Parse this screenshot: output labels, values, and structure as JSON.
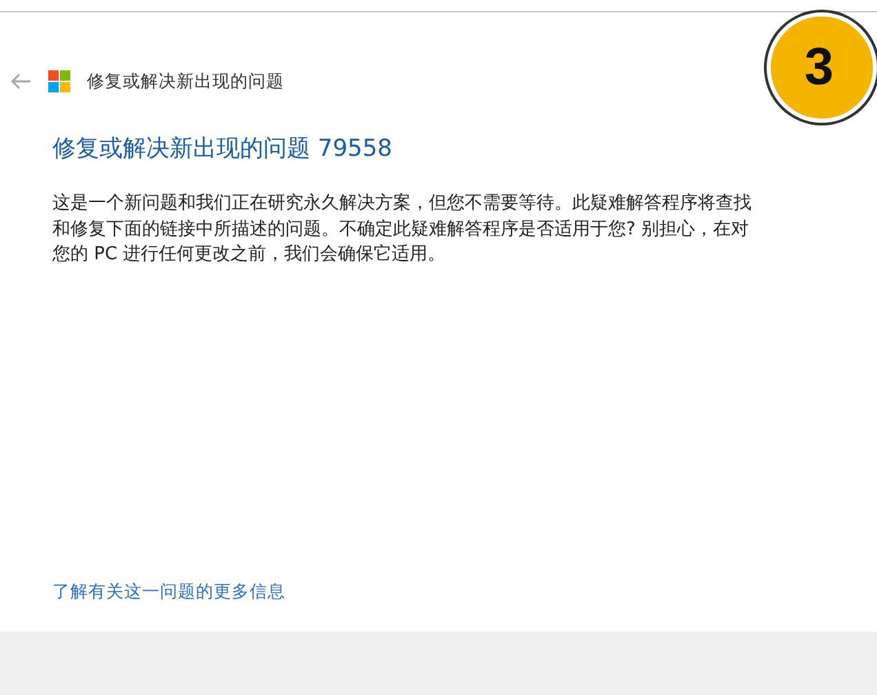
{
  "window": {
    "title": "修复或解决新出现的问题"
  },
  "heading": "修复或解决新出现的问题 79558",
  "description": "这是一个新问题和我们正在研究永久解决方案，但您不需要等待。此疑难解答程序将查找和修复下面的链接中所描述的问题。不确定此疑难解答程序是否适用于您? 别担心，在对您的 PC 进行任何更改之前，我们会确保它适用。",
  "more_info_link": "了解有关这一问题的更多信息",
  "step_badge": "3"
}
